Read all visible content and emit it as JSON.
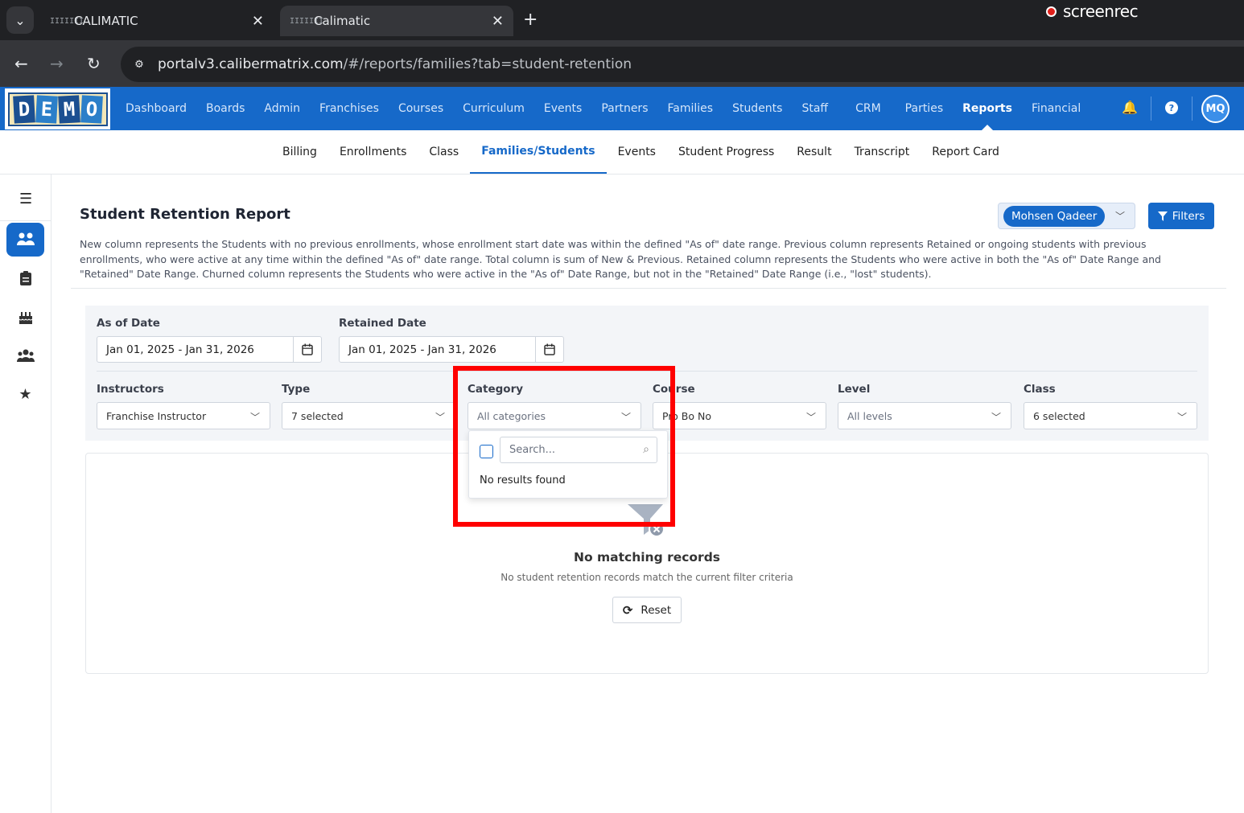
{
  "browser": {
    "tabs": [
      {
        "title": "CALIMATIC"
      },
      {
        "title": "Calimatic"
      }
    ],
    "favicon_text": "IIIIIII",
    "url_host": "portalv3.calibermatrix.com",
    "url_path": "/#/reports/families?tab=student-retention",
    "recorder_label": "screenrec"
  },
  "topnav": {
    "logo_letters": [
      "D",
      "E",
      "M",
      "O"
    ],
    "items": [
      "Dashboard",
      "Boards",
      "Admin",
      "Franchises",
      "Courses",
      "Curriculum",
      "Events",
      "Partners",
      "Families",
      "Students",
      "Staff",
      "CRM",
      "Parties",
      "Reports",
      "Financial"
    ],
    "active": "Reports",
    "avatar_initials": "MQ"
  },
  "subnav": {
    "items": [
      "Billing",
      "Enrollments",
      "Class",
      "Families/Students",
      "Events",
      "Student Progress",
      "Result",
      "Transcript",
      "Report Card"
    ],
    "active": "Families/Students"
  },
  "report": {
    "title": "Student Retention Report",
    "description": "New column represents the Students with no previous enrollments, whose enrollment start date was within the defined \"As of\" date range. Previous column represents Retained or ongoing students with previous enrollments, who were active at any time within the defined \"As of\" date range. Total column is sum of New & Previous. Retained column represents the Students who were active in both the \"As of\" Date Range and \"Retained\" Date Range. Churned column represents the Students who were active in the \"As of\" Date Range, but not in the \"Retained\" Date Range (i.e., \"lost\" students).",
    "user_selector": "Mohsen Qadeer",
    "filters_label": "Filters"
  },
  "filters": {
    "as_of_label": "As of Date",
    "as_of_value": "Jan 01, 2025 - Jan 31, 2026",
    "retained_label": "Retained Date",
    "retained_value": "Jan 01, 2025 - Jan 31, 2026",
    "selects": [
      {
        "label": "Instructors",
        "value": "Franchise Instructor"
      },
      {
        "label": "Type",
        "value": "7 selected"
      },
      {
        "label": "Category",
        "value": "All categories"
      },
      {
        "label": "Course",
        "value": "Pro Bo No"
      },
      {
        "label": "Level",
        "value": "All levels"
      },
      {
        "label": "Class",
        "value": "6 selected"
      }
    ]
  },
  "dropdown": {
    "search_placeholder": "Search...",
    "empty_text": "No results found"
  },
  "empty_state": {
    "title": "No matching records",
    "subtitle": "No student retention records match the current filter criteria",
    "reset_label": "Reset"
  },
  "colors": {
    "primary": "#1669c9",
    "highlight": "#ff0000"
  }
}
